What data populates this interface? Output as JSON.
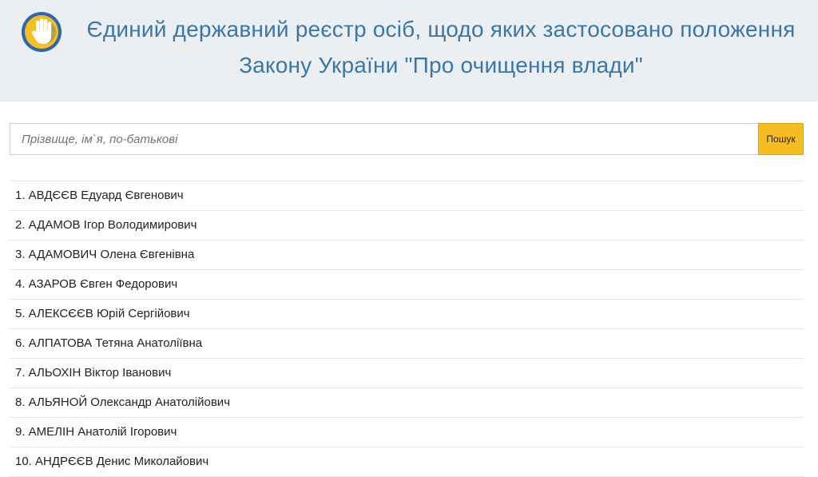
{
  "header": {
    "title": "Єдиний державний реєстр осіб, щодо яких застосовано положення Закону України \"Про очищення влади\""
  },
  "search": {
    "placeholder": "Прізвище, ім`я, по-батькові",
    "value": "",
    "button_label": "Пошук"
  },
  "colors": {
    "title": "#3a77a8",
    "header_bg": "#ebeff2",
    "button_bg": "#f5bd1f",
    "logo_blue": "#2f66ad",
    "logo_yellow": "#f4c021"
  },
  "results": [
    {
      "label": "1. АВДЄЄВ Едуард Євгенович"
    },
    {
      "label": "2. АДАМОВ Ігор Володимирович"
    },
    {
      "label": "3. АДАМОВИЧ Олена Євгенівна"
    },
    {
      "label": "4. АЗАРОВ Євген Федорович"
    },
    {
      "label": "5. АЛЕКСЄЄВ Юрій Сергійович"
    },
    {
      "label": "6. АЛПАТОВА Тетяна Анатоліївна"
    },
    {
      "label": "7. АЛЬОХІН Віктор Іванович"
    },
    {
      "label": "8. АЛЬЯНОЙ Олександр Анатолійович"
    },
    {
      "label": "9. АМЕЛІН Анатолій Ігорович"
    },
    {
      "label": "10. АНДРЄЄВ Денис Миколайович"
    }
  ]
}
